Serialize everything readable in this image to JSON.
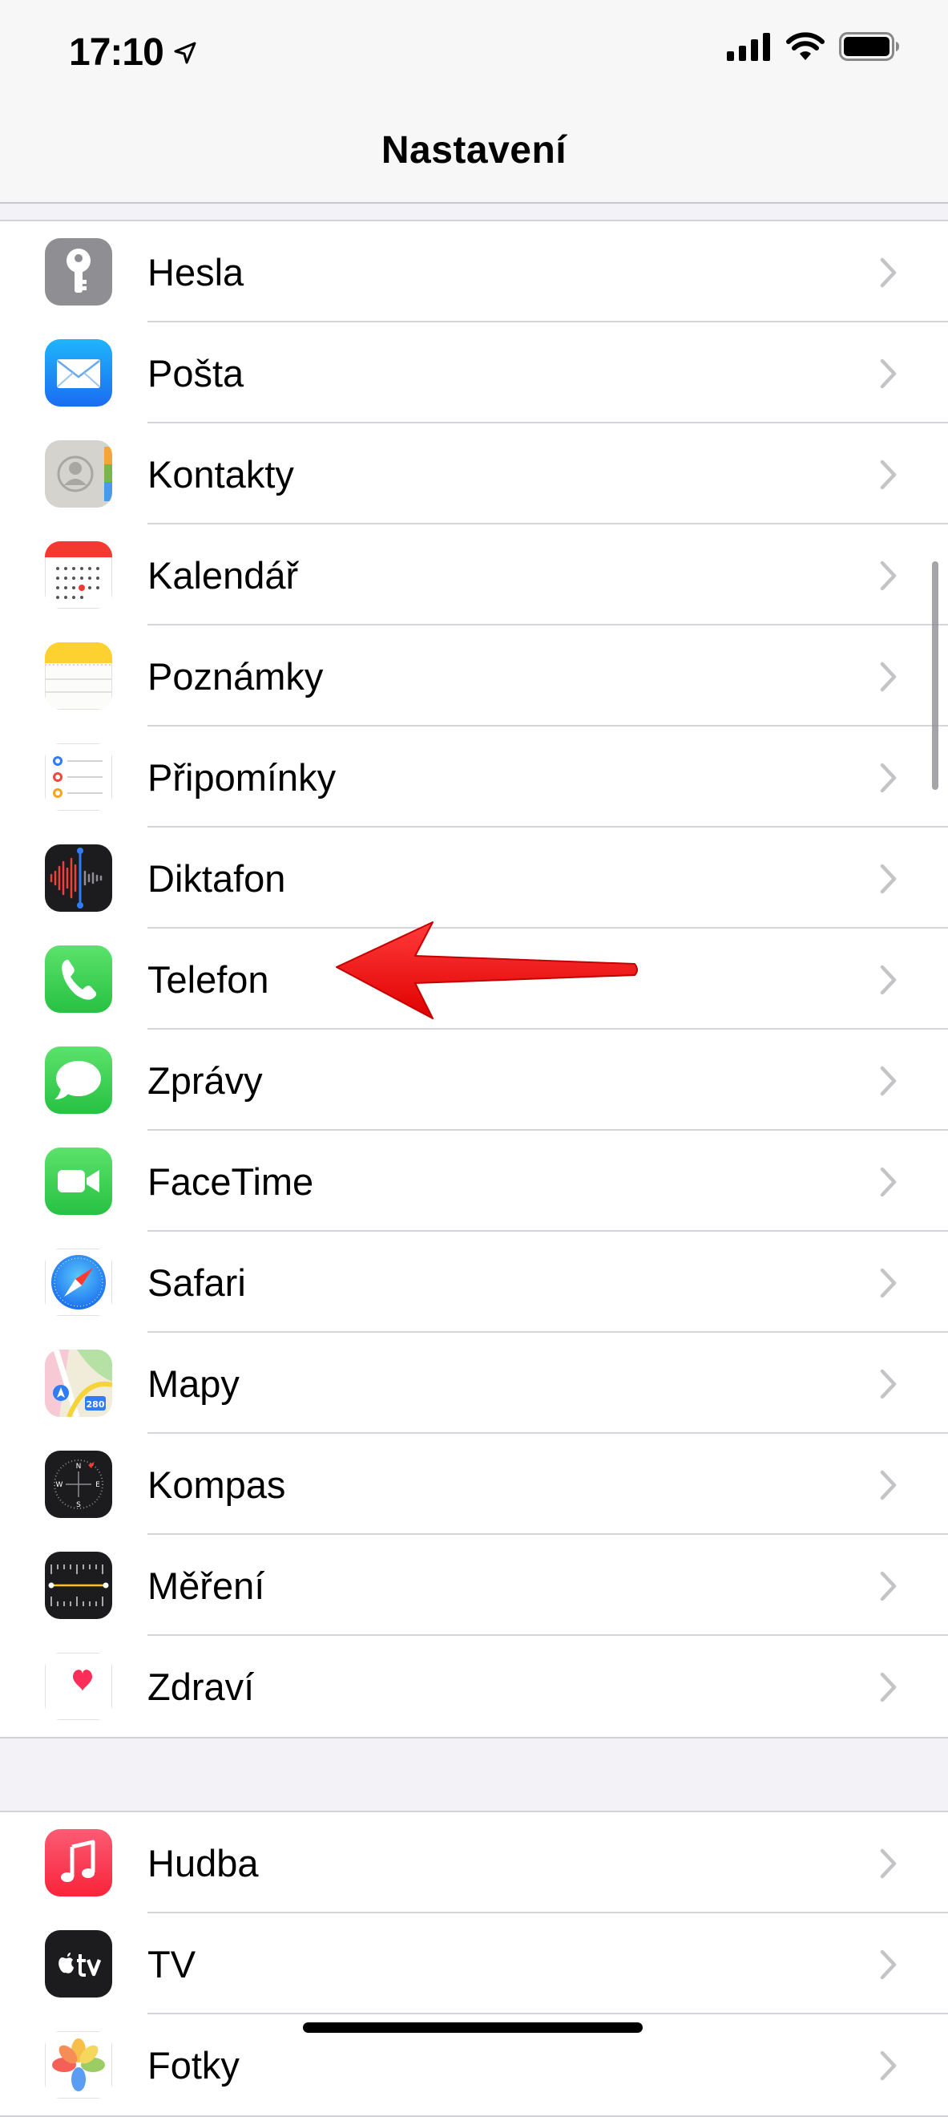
{
  "status_bar": {
    "time": "17:10",
    "icons": [
      "location-arrow-icon",
      "cellular-signal-icon",
      "wifi-icon",
      "battery-icon"
    ]
  },
  "nav": {
    "title": "Nastavení"
  },
  "group1": [
    {
      "label": "Hesla",
      "icon": "key-icon"
    },
    {
      "label": "Pošta",
      "icon": "mail-icon"
    },
    {
      "label": "Kontakty",
      "icon": "contacts-icon"
    },
    {
      "label": "Kalendář",
      "icon": "calendar-icon"
    },
    {
      "label": "Poznámky",
      "icon": "notes-icon"
    },
    {
      "label": "Připomínky",
      "icon": "reminders-icon"
    },
    {
      "label": "Diktafon",
      "icon": "voice-memos-icon"
    },
    {
      "label": "Telefon",
      "icon": "phone-icon"
    },
    {
      "label": "Zprávy",
      "icon": "messages-icon"
    },
    {
      "label": "FaceTime",
      "icon": "facetime-icon"
    },
    {
      "label": "Safari",
      "icon": "safari-icon"
    },
    {
      "label": "Mapy",
      "icon": "maps-icon"
    },
    {
      "label": "Kompas",
      "icon": "compass-icon"
    },
    {
      "label": "Měření",
      "icon": "measure-icon"
    },
    {
      "label": "Zdraví",
      "icon": "health-icon"
    }
  ],
  "group2": [
    {
      "label": "Hudba",
      "icon": "music-icon"
    },
    {
      "label": "TV",
      "icon": "tv-icon"
    },
    {
      "label": "Fotky",
      "icon": "photos-icon"
    }
  ],
  "annotation": {
    "icon": "red-arrow-icon",
    "color": "#ff1a1a"
  },
  "colors": {
    "background": "#f2f2f7",
    "separator": "#d6d6da",
    "chevron": "#c4c4c7"
  }
}
